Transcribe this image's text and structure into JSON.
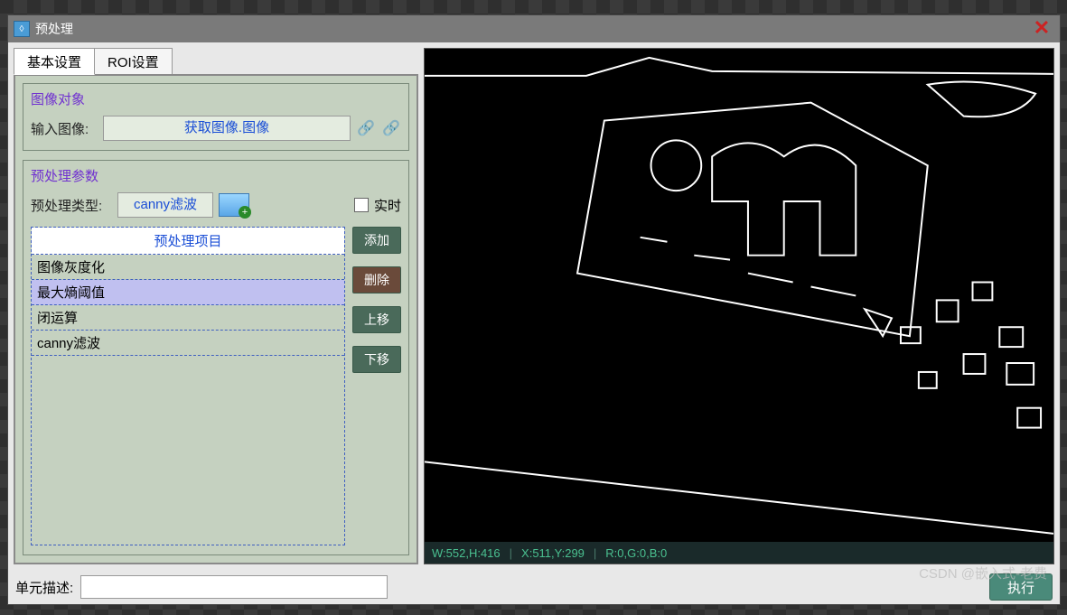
{
  "window": {
    "title": "预处理"
  },
  "tabs": {
    "basic": "基本设置",
    "roi": "ROI设置",
    "active": 0
  },
  "image_object": {
    "group_title": "图像对象",
    "input_label": "输入图像:",
    "input_value": "获取图像.图像"
  },
  "preprocess_params": {
    "group_title": "预处理参数",
    "type_label": "预处理类型:",
    "type_value": "canny滤波",
    "realtime_label": "实时",
    "realtime_checked": false
  },
  "items": {
    "header": "预处理项目",
    "list": [
      "图像灰度化",
      "最大熵阈值",
      "闭运算",
      "canny滤波"
    ],
    "selected_index": 1
  },
  "buttons": {
    "add": "添加",
    "delete": "删除",
    "up": "上移",
    "down": "下移"
  },
  "status": {
    "wh": "W:552,H:416",
    "xy": "X:511,Y:299",
    "rgb": "R:0,G:0,B:0"
  },
  "footer": {
    "desc_label": "单元描述:",
    "desc_value": "",
    "exec": "执行"
  },
  "watermark": "CSDN @嵌入式-老费"
}
